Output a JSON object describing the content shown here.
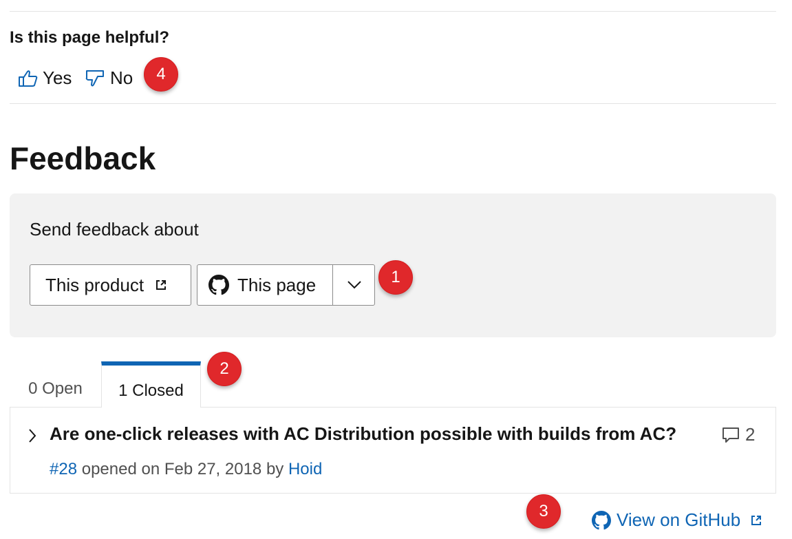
{
  "helpful": {
    "title": "Is this page helpful?",
    "yes_label": "Yes",
    "no_label": "No"
  },
  "feedback": {
    "title": "Feedback",
    "send_label": "Send feedback about",
    "product_button": "This product",
    "page_button": "This page"
  },
  "tabs": [
    {
      "label": "0 Open",
      "active": false
    },
    {
      "label": "1 Closed",
      "active": true
    }
  ],
  "issues": [
    {
      "title": "Are one-click releases with AC Distribution possible with builds from AC?",
      "number": "#28",
      "opened_text": " opened on Feb 27, 2018 by ",
      "author": "Hoid",
      "comment_count": "2"
    }
  ],
  "view_on_github": "View on GitHub",
  "badges": [
    "1",
    "2",
    "3",
    "4"
  ],
  "colors": {
    "accent": "#0f65b4",
    "badge": "#e0282b",
    "panel_bg": "#f2f2f2"
  }
}
